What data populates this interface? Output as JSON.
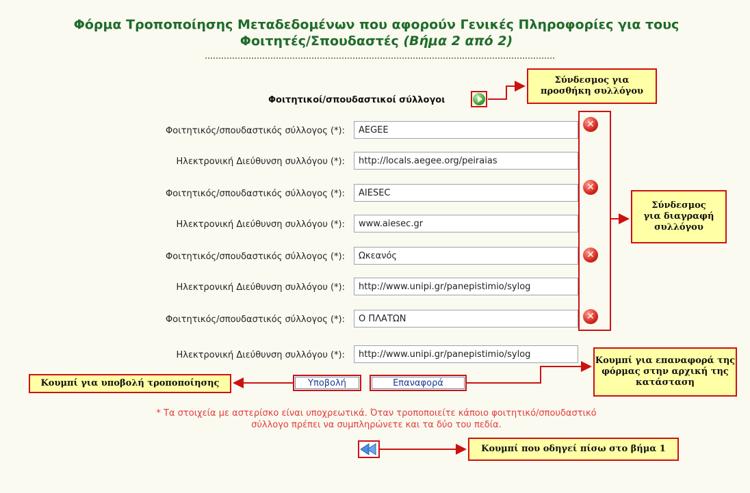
{
  "page": {
    "title_line1": "Φόρμα Τροποποίησης Μεταδεδομένων που αφορούν Γενικές Πληροφορίες για τους",
    "title_line2_main": "Φοιτητές/Σπουδαστές ",
    "title_line2_step": "(Βήμα 2 από 2)"
  },
  "form": {
    "section_label": "Φοιτητικοί/σπουδαστικοί σύλλογοι",
    "add_icon": "play-circle-green-icon",
    "delete_icon": "x-circle-red-icon",
    "back_icon": "double-left-arrow-icon",
    "associations": [
      {
        "name_label": "Φοιτητικός/σπουδαστικός σύλλογος (*):",
        "name_value": "AEGEE",
        "url_label": "Ηλεκτρονική Διεύθυνση συλλόγου (*):",
        "url_value": "http://locals.aegee.org/peiraias"
      },
      {
        "name_label": "Φοιτητικός/σπουδαστικός σύλλογος (*):",
        "name_value": "AIESEC",
        "url_label": "Ηλεκτρονική Διεύθυνση συλλόγου (*):",
        "url_value": "www.aiesec.gr"
      },
      {
        "name_label": "Φοιτητικός/σπουδαστικός σύλλογος (*):",
        "name_value": "Ωκεανός",
        "url_label": "Ηλεκτρονική Διεύθυνση συλλόγου (*):",
        "url_value": "http://www.unipi.gr/panepistimio/sylog"
      },
      {
        "name_label": "Φοιτητικός/σπουδαστικός σύλλογος (*):",
        "name_value": "Ο ΠΛΑΤΩΝ",
        "url_label": "Ηλεκτρονική Διεύθυνση συλλόγου (*):",
        "url_value": "http://www.unipi.gr/panepistimio/sylog"
      }
    ],
    "submit_label": "Υποβολή",
    "reset_label": "Επαναφορά",
    "note_line1": "* Τα στοιχεία με αστερίσκο είναι υποχρεωτικά. Όταν τροποποιείτε κάποιο φοιτητικό/σπουδαστικό",
    "note_line2": "σύλλογο πρέπει να συμπληρώνετε και τα δύο του πεδία."
  },
  "callouts": {
    "add_line1": "Σύνδεσμος για",
    "add_line2": "προσθήκη συλλόγου",
    "delete_line1": "Σύνδεσμος",
    "delete_line2": "για διαγραφή",
    "delete_line3": "συλλόγου",
    "submit": "Κουμπί για υποβολή τροποποίησης",
    "reset_line1": "Κουμπί για επαναφορά της",
    "reset_line2": "φόρμας στην αρχική της",
    "reset_line3": "κατάσταση",
    "back": "Κουμπί που οδηγεί πίσω στο βήμα 1"
  },
  "colors": {
    "title": "#1f6b2a",
    "callout_bg": "#ffffa6",
    "callout_border": "#cc1111",
    "note": "#e23a3a"
  }
}
